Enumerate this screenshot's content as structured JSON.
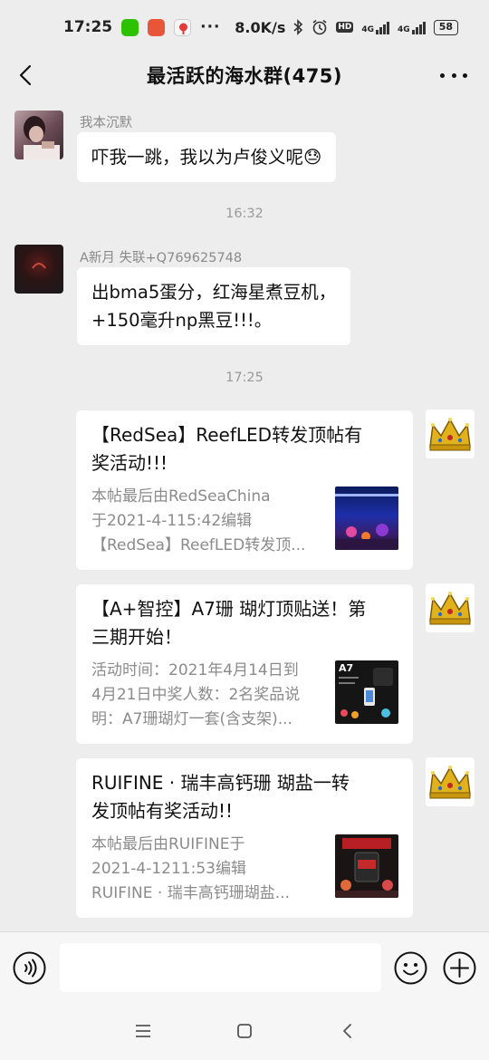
{
  "status_bar": {
    "time": "17:25",
    "net_speed": "8.0K/s",
    "hd_badge": "HD",
    "network_1": "4G",
    "network_2": "4G",
    "battery": "58",
    "more": "···"
  },
  "header": {
    "title": "最活跃的海水群(475)"
  },
  "messages": [
    {
      "sender": "我本沉默",
      "text": "吓我一跳，我以为卢俊义呢😓"
    },
    {
      "sender": "A新月 失联+Q769625748",
      "text_line1": "出bma5蛋分，红海星煮豆机，",
      "text_line2": "+150毫升np黑豆!!!。"
    }
  ],
  "timestamps": [
    "16:32",
    "17:25"
  ],
  "cards": [
    {
      "title_line1": "【RedSea】ReefLED转发顶帖有",
      "title_line2": "奖活动!!!",
      "desc_line1": "本帖最后由RedSeaChina",
      "desc_line2": "于2021-4-115:42编辑",
      "desc_line3": "【RedSea】ReefLED转发顶...",
      "thumb_icon": "aquarium-thumb"
    },
    {
      "title_line1": "【A+智控】A7珊 瑚灯顶贴送！第",
      "title_line2": "三期开始！",
      "desc_line1": "活动时间：2021年4月14日到",
      "desc_line2": "4月21日中奖人数：2名奖品说",
      "desc_line3": "明：A7珊瑚灯一套(含支架)...",
      "thumb_label": "A7",
      "thumb_icon": "coral-light-thumb"
    },
    {
      "title_line1": "RUIFINE · 瑞丰高钙珊 瑚盐一转",
      "title_line2": "发顶帖有奖活动!!",
      "desc_line1": "本帖最后由RUIFINE于",
      "desc_line2": "2021-4-1211:53编辑",
      "desc_line3": "RUIFINE · 瑞丰高钙珊瑚盐...",
      "thumb_icon": "salt-bucket-thumb"
    }
  ],
  "input": {
    "placeholder": ""
  },
  "colors": {
    "background": "#ededed",
    "bubble": "#ffffff",
    "meta_text": "#8a8a8a",
    "crown_gold": "#e2b21c"
  }
}
